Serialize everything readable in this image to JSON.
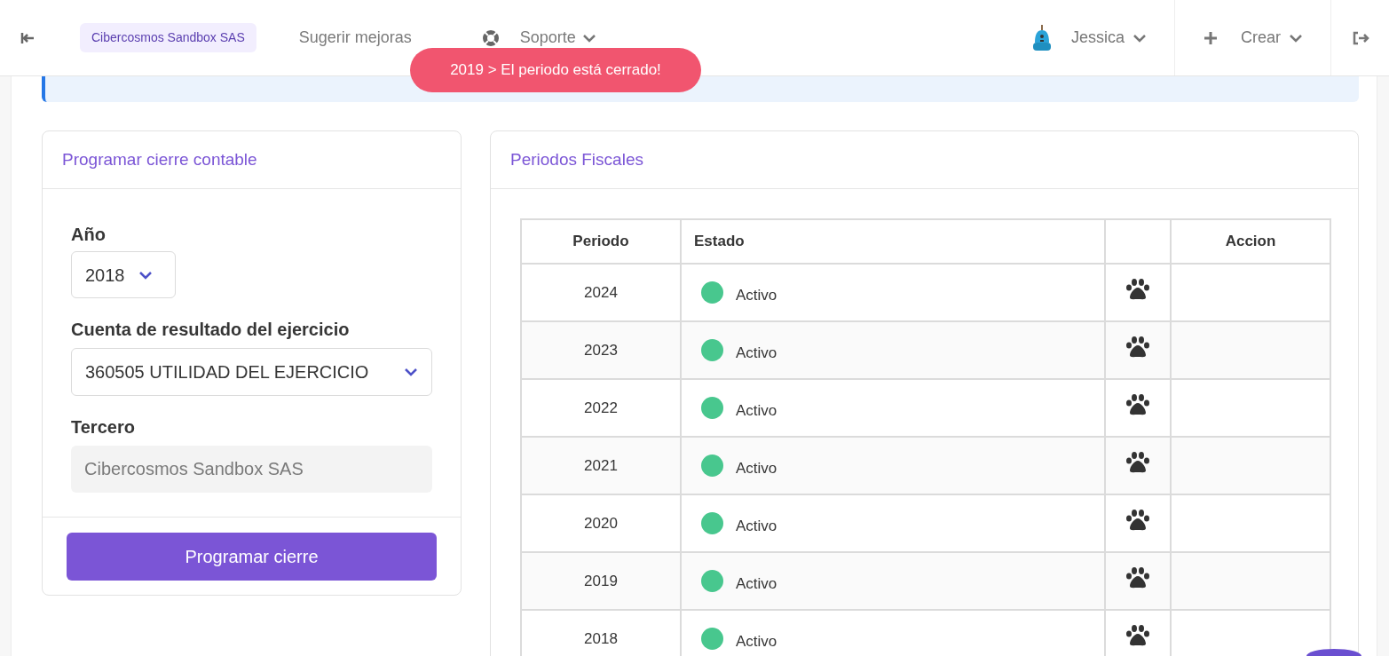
{
  "header": {
    "company": "Cibercosmos Sandbox SAS",
    "links": [
      {
        "label": "Sugerir mejoras",
        "kind": "plain"
      },
      {
        "label": "Soporte",
        "kind": "support"
      }
    ],
    "user": "Jessica",
    "create": "Crear"
  },
  "toast": "2019 > El periodo está cerrado!",
  "closing_form": {
    "title": "Programar cierre contable",
    "year_label": "Año",
    "year_value": "2018",
    "account_label": "Cuenta de resultado del ejercicio",
    "account_value": "360505 UTILIDAD DEL EJERCICIO",
    "third_label": "Tercero",
    "third_value": "Cibercosmos Sandbox SAS",
    "submit": "Programar cierre"
  },
  "fiscal_periods": {
    "title": "Periodos Fiscales",
    "columns": [
      "Periodo",
      "Estado",
      "Accion"
    ],
    "rows": [
      {
        "period": "2024",
        "status": "Activo",
        "color": "#48c78e"
      },
      {
        "period": "2023",
        "status": "Activo",
        "color": "#48c78e"
      },
      {
        "period": "2022",
        "status": "Activo",
        "color": "#48c78e"
      },
      {
        "period": "2021",
        "status": "Activo",
        "color": "#48c78e"
      },
      {
        "period": "2020",
        "status": "Activo",
        "color": "#48c78e"
      },
      {
        "period": "2019",
        "status": "Activo",
        "color": "#48c78e"
      },
      {
        "period": "2018",
        "status": "Activo",
        "color": "#48c78e"
      }
    ]
  }
}
